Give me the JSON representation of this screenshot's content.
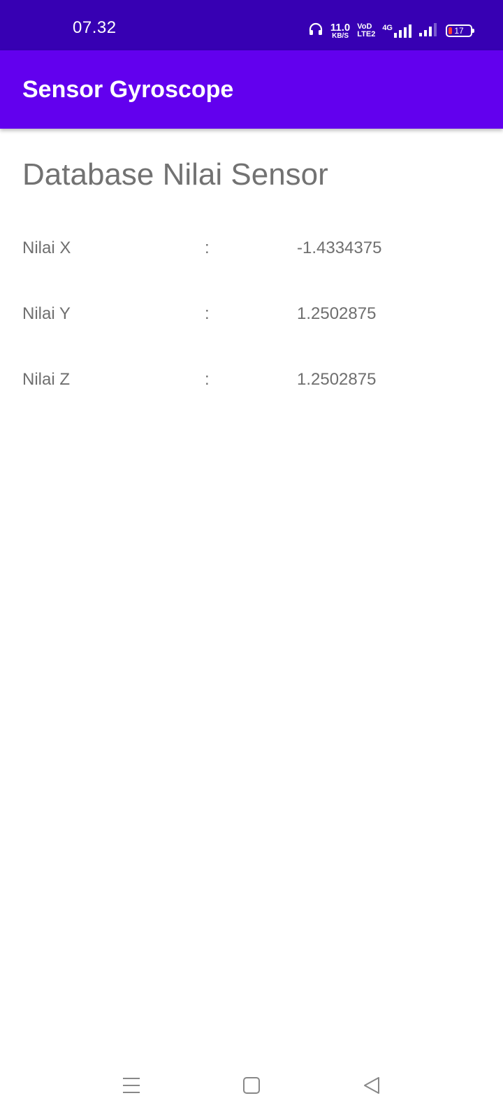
{
  "status_bar": {
    "time": "07.32",
    "net_speed": "11.0",
    "net_unit": "KB/S",
    "volte_top": "VoD",
    "volte_bottom": "LTE2",
    "network": "4G",
    "battery_level": "17",
    "battery_fraction": 0.17,
    "icons": [
      "headphones-icon",
      "signal-sim1-icon",
      "signal-sim2-icon",
      "battery-icon"
    ]
  },
  "app_bar": {
    "title": "Sensor Gyroscope"
  },
  "main": {
    "heading": "Database Nilai Sensor",
    "rows": [
      {
        "label": "Nilai X",
        "separator": ":",
        "value": "-1.4334375"
      },
      {
        "label": "Nilai Y",
        "separator": ":",
        "value": "1.2502875"
      },
      {
        "label": "Nilai Z",
        "separator": ":",
        "value": "1.2502875"
      }
    ]
  },
  "nav_bar": {
    "icons": [
      "recents-menu-icon",
      "home-square-icon",
      "back-triangle-icon"
    ]
  },
  "colors": {
    "status_bar": "#3700B3",
    "app_bar": "#6200EE",
    "text_gray": "#727272",
    "battery_low": "#ff3b30"
  }
}
